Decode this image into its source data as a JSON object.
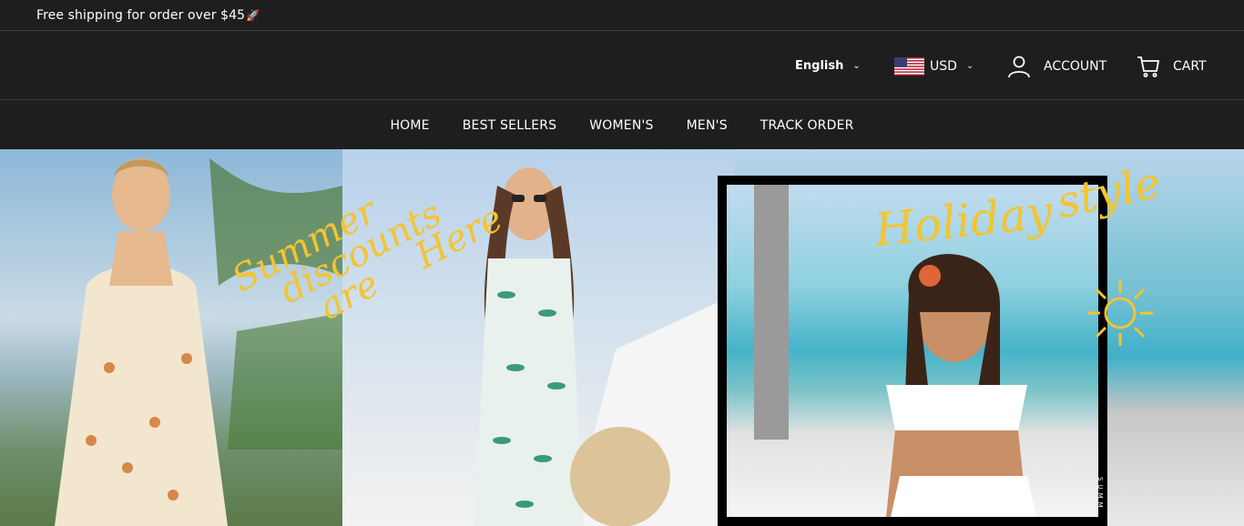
{
  "announcement": {
    "text": "Free shipping for order over $45",
    "icon": "rocket-icon"
  },
  "header": {
    "language": "English",
    "currency": "USD",
    "account_label": "ACCOUNT",
    "cart_label": "CART"
  },
  "nav": {
    "items": [
      {
        "label": "HOME"
      },
      {
        "label": "BEST SELLERS"
      },
      {
        "label": "WOMEN'S"
      },
      {
        "label": "MEN'S"
      },
      {
        "label": "TRACK ORDER"
      }
    ]
  },
  "hero": {
    "handwriting_left": [
      "Summer",
      "discounts",
      "are",
      "Here"
    ],
    "handwriting_right": [
      "Holiday",
      "style"
    ],
    "side_text": "SUMM"
  },
  "colors": {
    "background": "#1e1e1e",
    "accent_yellow": "#f4c430",
    "divider": "#3a3a3a"
  }
}
